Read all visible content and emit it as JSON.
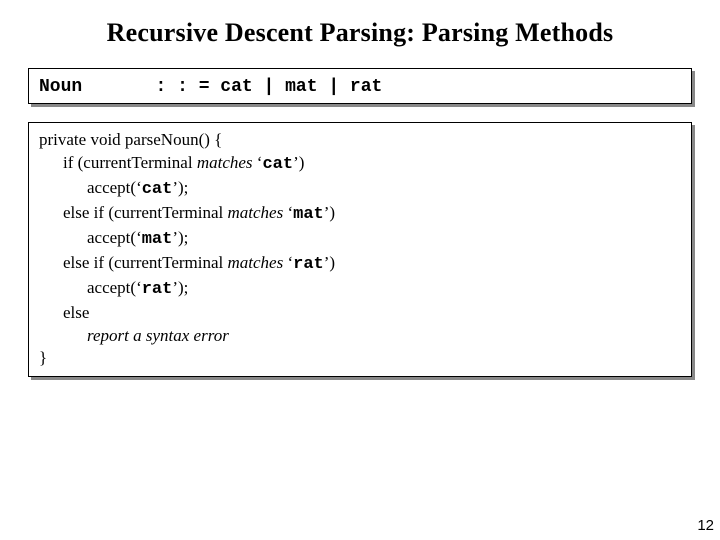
{
  "title": "Recursive Descent Parsing: Parsing Methods",
  "grammar": {
    "lhs": "Noun",
    "rhs": ": : = cat | mat | rat"
  },
  "code": {
    "sig_pre": "private void ",
    "sig_name": "parseNoun() {",
    "if_kw": "if (",
    "elseif_kw": "else if (",
    "else_kw": "else",
    "cur_term": "currentTerminal",
    "matches": " matches ",
    "lq": " ‘",
    "rq": "’)",
    "tok_cat": "cat",
    "tok_mat": "mat",
    "tok_rat": "rat",
    "accept_pre": "accept(‘",
    "accept_post": "’);",
    "report": "report a syntax error",
    "close": "}"
  },
  "page_number": "12"
}
